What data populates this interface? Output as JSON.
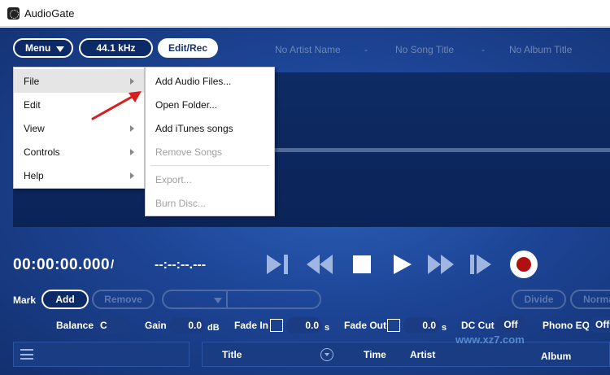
{
  "window": {
    "title": "AudioGate"
  },
  "toolbar": {
    "menu_label": "Menu",
    "sample_rate": "44.1 kHz",
    "edit_rec_label": "Edit/Rec"
  },
  "meta": {
    "artist": "No Artist Name",
    "sep1": "-",
    "song": "No Song Title",
    "sep2": "-",
    "album": "No Album Title"
  },
  "transport": {
    "current_time": "00:00:00.000",
    "separator": "/",
    "total_time": "--:--:--.---"
  },
  "mark": {
    "label": "Mark",
    "add_label": "Add",
    "remove_label": "Remove"
  },
  "edit": {
    "divide_label": "Divide",
    "normalize_label": "Norma"
  },
  "params": {
    "balance_label": "Balance",
    "balance_value": "C",
    "gain_label": "Gain",
    "gain_value": "0.0",
    "gain_unit": "dB",
    "fade_in_label": "Fade In",
    "fade_in_value": "0.0",
    "fade_in_unit": "s",
    "fade_out_label": "Fade Out",
    "fade_out_value": "0.0",
    "fade_out_unit": "s",
    "dc_cut_label": "DC Cut",
    "dc_cut_value": "Off",
    "phono_eq_label": "Phono EQ",
    "phono_eq_value": "Off"
  },
  "list_header": {
    "title": "Title",
    "time": "Time",
    "artist": "Artist",
    "album": "Album"
  },
  "main_menu": {
    "items": [
      {
        "label": "File",
        "has_submenu": true
      },
      {
        "label": "Edit",
        "has_submenu": false
      },
      {
        "label": "View",
        "has_submenu": true
      },
      {
        "label": "Controls",
        "has_submenu": true
      },
      {
        "label": "Help",
        "has_submenu": true
      }
    ]
  },
  "file_submenu": {
    "items": [
      {
        "label": "Add Audio Files...",
        "enabled": true
      },
      {
        "label": "Open Folder...",
        "enabled": true
      },
      {
        "label": "Add iTunes songs",
        "enabled": true
      },
      {
        "label": "Remove Songs",
        "enabled": false
      },
      {
        "label": "Export...",
        "enabled": false
      },
      {
        "label": "Burn Disc...",
        "enabled": false
      }
    ]
  },
  "colors": {
    "background": "#1d4596",
    "record": "#b01010",
    "annotation_arrow": "#d81e1e"
  },
  "icons": {
    "transport": [
      "skip-to-end-icon",
      "rewind-icon",
      "stop-icon",
      "play-icon",
      "fast-forward-icon",
      "skip-forward-icon",
      "record-icon"
    ]
  },
  "watermark": "www.xz7.com"
}
